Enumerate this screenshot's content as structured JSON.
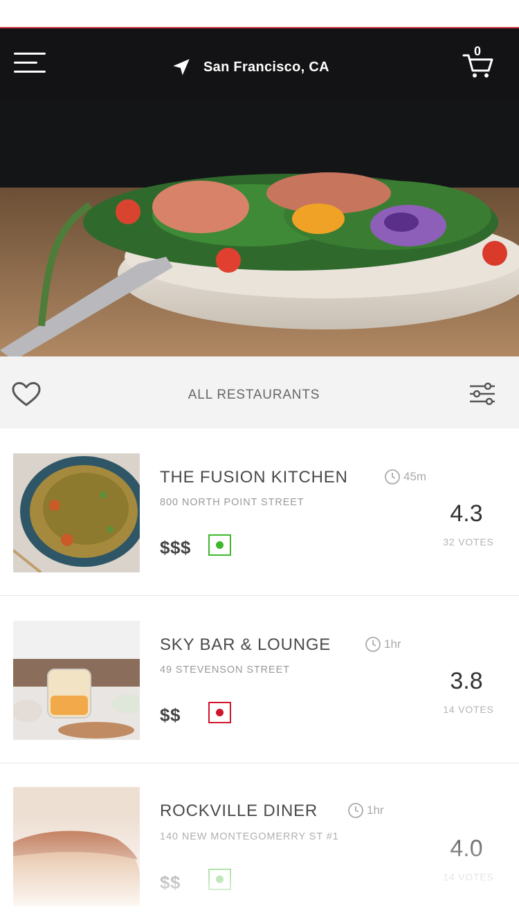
{
  "header": {
    "location": "San Francisco, CA",
    "cart_count": "0"
  },
  "filter": {
    "title": "ALL RESTAURANTS"
  },
  "restaurants": [
    {
      "name": "THE FUSION KITCHEN",
      "time": "45m",
      "address": "800 NORTH POINT STREET",
      "price": "$$$",
      "veg": true,
      "rating": "4.3",
      "votes": "32 VOTES"
    },
    {
      "name": "SKY BAR & LOUNGE",
      "time": "1hr",
      "address": "49 STEVENSON STREET",
      "price": "$$",
      "veg": false,
      "rating": "3.8",
      "votes": "14 VOTES"
    },
    {
      "name": "ROCKVILLE DINER",
      "time": "1hr",
      "address": "140 NEW MONTEGOMERRY ST #1",
      "price": "$$",
      "veg": true,
      "rating": "4.0",
      "votes": "14 VOTES"
    }
  ],
  "icons": {
    "menu": "hamburger-menu-icon",
    "location": "navigation-arrow-icon",
    "cart": "shopping-cart-icon",
    "favorite": "heart-icon",
    "filter": "sliders-icon",
    "time": "clock-icon"
  },
  "colors": {
    "veg": "#3db82a",
    "non_veg": "#d0142a",
    "accent_line": "#c9353f"
  }
}
